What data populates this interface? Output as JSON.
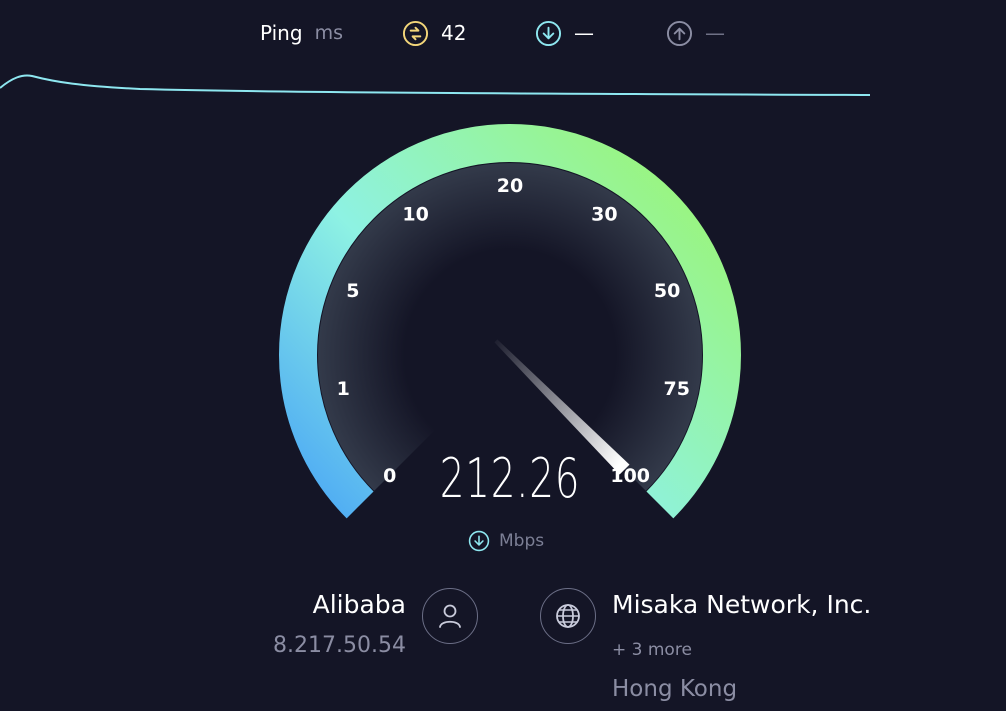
{
  "stats": {
    "ping_label": "Ping",
    "ping_unit": "ms",
    "latency_value": "42",
    "download_value": "—",
    "upload_value": "—"
  },
  "gauge": {
    "ticks": [
      "0",
      "1",
      "5",
      "10",
      "20",
      "30",
      "50",
      "75",
      "100"
    ],
    "needle_value": 100,
    "reading": "212.26",
    "unit": "Mbps"
  },
  "server": {
    "name": "Alibaba",
    "ip": "8.217.50.54"
  },
  "isp": {
    "name": "Misaka Network, Inc.",
    "more": "+ 3 more",
    "location": "Hong Kong"
  },
  "colors": {
    "background": "#141526",
    "gauge_start": "#4aa6f5",
    "gauge_mid": "#8ef2e3",
    "gauge_end": "#9af57c",
    "latency_icon": "#f3d67a",
    "download_icon": "#8ee7f0",
    "upload_icon": "#8b8da3",
    "trace_line": "#8ee7f0"
  },
  "icons": {
    "latency": "latency-icon",
    "download": "download-arrow-icon",
    "upload": "upload-arrow-icon",
    "server": "user-icon",
    "isp": "globe-icon"
  }
}
